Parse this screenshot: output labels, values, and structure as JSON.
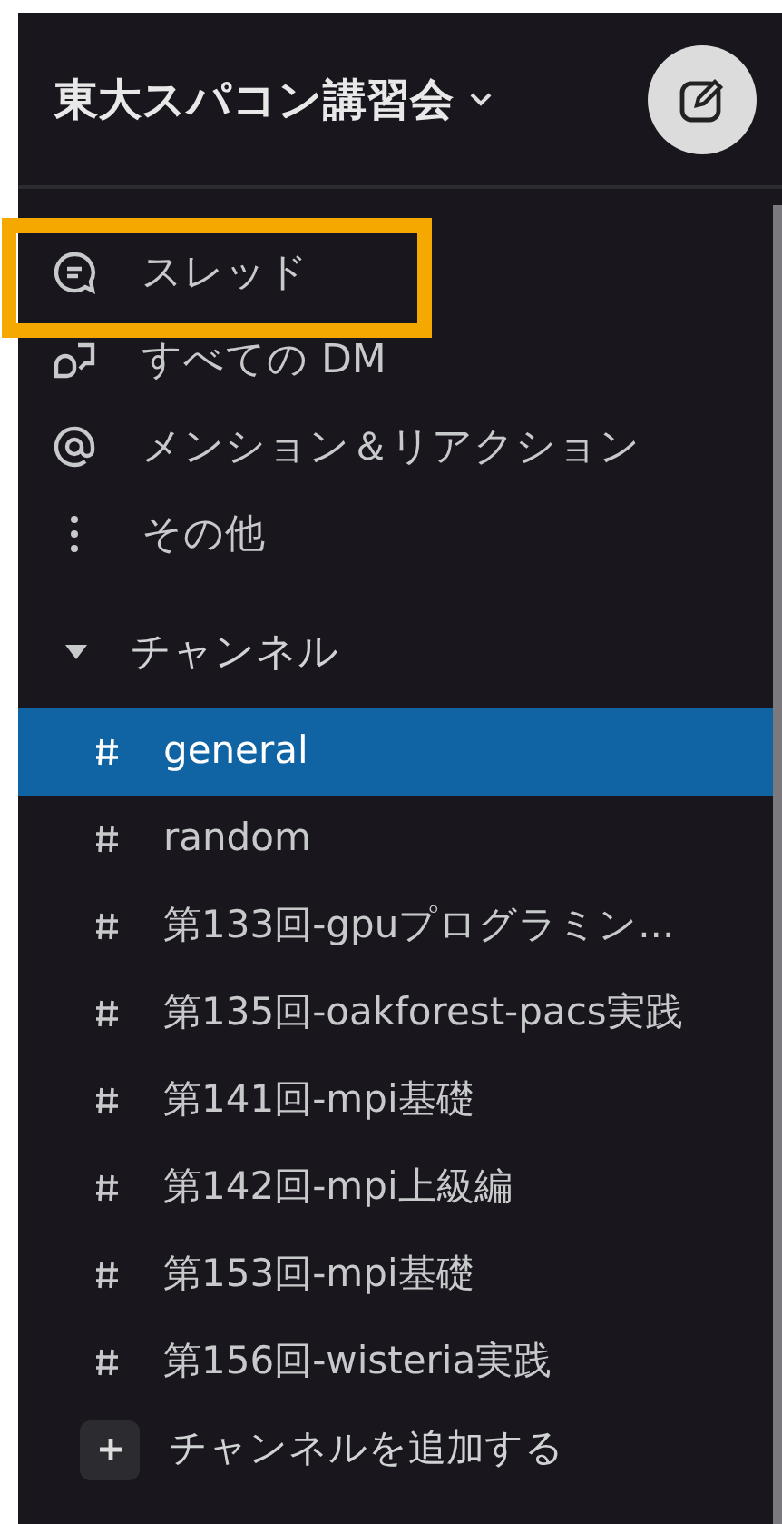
{
  "workspace": {
    "name": "東大スパコン講習会"
  },
  "nav": [
    {
      "kind": "threads",
      "label": "スレッド",
      "highlighted": true
    },
    {
      "kind": "dms",
      "label": "すべての DM",
      "highlighted": false
    },
    {
      "kind": "mentions",
      "label": "メンション＆リアクション",
      "highlighted": false
    },
    {
      "kind": "more",
      "label": "その他",
      "highlighted": false
    }
  ],
  "section": {
    "label": "チャンネル",
    "expanded": true
  },
  "channels": [
    {
      "name": "general",
      "selected": true
    },
    {
      "name": "random",
      "selected": false
    },
    {
      "name": "第133回-gpuプログラミン...",
      "selected": false
    },
    {
      "name": "第135回-oakforest-pacs実践",
      "selected": false
    },
    {
      "name": "第141回-mpi基礎",
      "selected": false
    },
    {
      "name": "第142回-mpi上級編",
      "selected": false
    },
    {
      "name": "第153回-mpi基礎",
      "selected": false
    },
    {
      "name": "第156回-wisteria実践",
      "selected": false
    }
  ],
  "add_channel": {
    "label": "チャンネルを追加する"
  }
}
